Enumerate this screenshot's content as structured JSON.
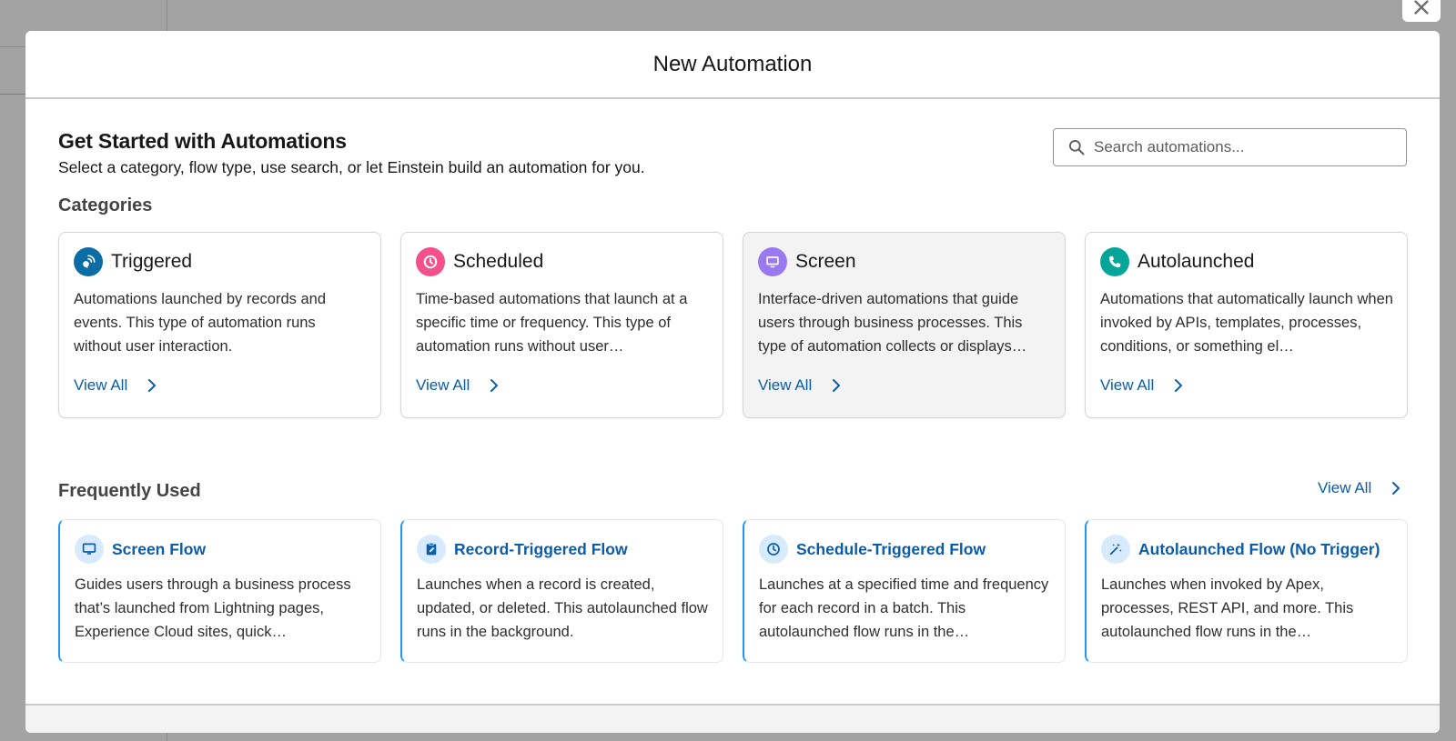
{
  "modal": {
    "title": "New Automation",
    "close_label": "Close"
  },
  "intro": {
    "heading": "Get Started with Automations",
    "subtitle": "Select a category, flow type, use search, or let Einstein build an automation for you."
  },
  "search": {
    "placeholder": "Search automations...",
    "value": ""
  },
  "categories": {
    "label": "Categories",
    "items": [
      {
        "title": "Triggered",
        "icon": "satellite-signal-icon",
        "icon_color": "#0b6ca6",
        "description": "Automations launched by records and events. This type of automation runs without user interaction.",
        "link": "View All"
      },
      {
        "title": "Scheduled",
        "icon": "clock-icon",
        "icon_color": "#f4508c",
        "description": "Time-based automations that launch at a specific time or frequency. This type of automation runs without user…",
        "link": "View All"
      },
      {
        "title": "Screen",
        "icon": "monitor-icon",
        "icon_color": "#9a78f0",
        "description": "Interface-driven automations that guide users through business processes. This type of automation collects or displays…",
        "link": "View All"
      },
      {
        "title": "Autolaunched",
        "icon": "phone-icon",
        "icon_color": "#06a59a",
        "description": "Automations that automatically launch when invoked by APIs, templates, processes, conditions, or something el…",
        "link": "View All"
      }
    ]
  },
  "frequently_used": {
    "label": "Frequently Used",
    "view_all": "View All",
    "items": [
      {
        "title": "Screen Flow",
        "icon": "monitor-icon",
        "description": "Guides users through a business process that’s launched from Lightning pages, Experience Cloud sites, quick…"
      },
      {
        "title": "Record-Triggered Flow",
        "icon": "clipboard-edit-icon",
        "description": "Launches when a record is created, updated, or deleted. This autolaunched flow runs in the background."
      },
      {
        "title": "Schedule-Triggered Flow",
        "icon": "clock-icon",
        "description": "Launches at a specified time and frequency for each record in a batch. This autolaunched flow runs in the…"
      },
      {
        "title": "Autolaunched Flow (No Trigger)",
        "icon": "magic-wand-icon",
        "description": "Launches when invoked by Apex, processes, REST API, and more. This autolaunched flow runs in the…"
      }
    ]
  },
  "colors": {
    "link": "#0b5cab",
    "accent_border": "#1b96ff",
    "icon_bg": "#d8ebfe"
  }
}
